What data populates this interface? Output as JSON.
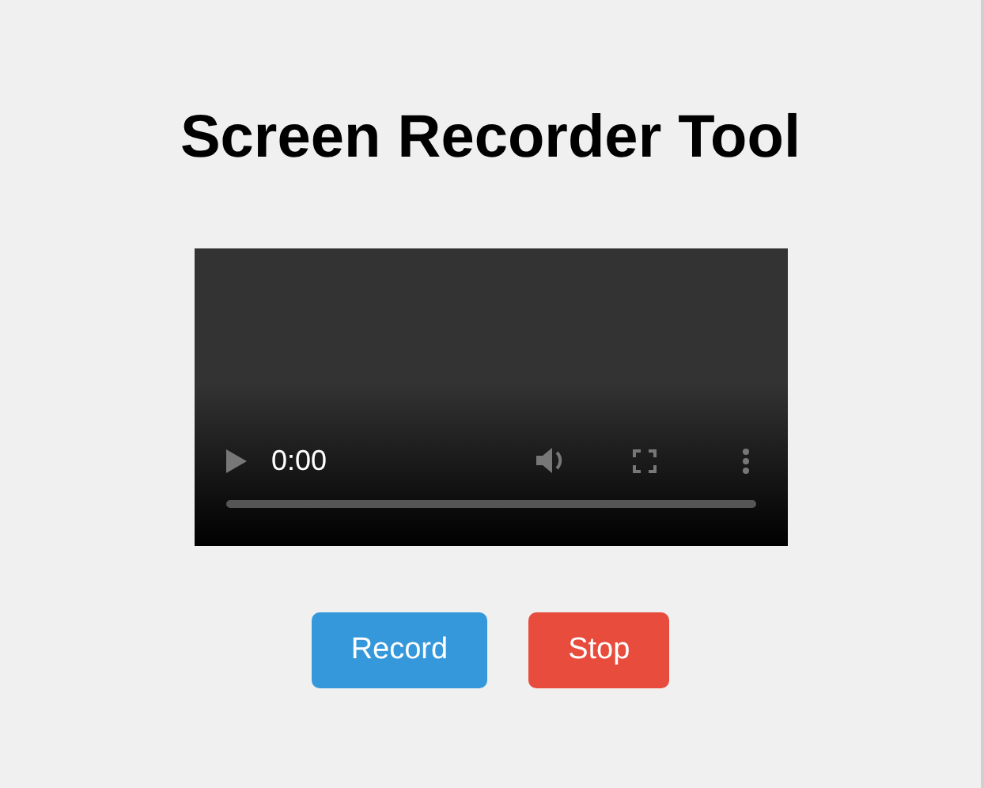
{
  "title": "Screen Recorder Tool",
  "player": {
    "time": "0:00",
    "progress": {
      "level": 0
    }
  },
  "buttons": [
    {
      "label": "Record",
      "color": "#3498db"
    },
    {
      "label": "Stop",
      "color": "#e74c3c"
    }
  ]
}
